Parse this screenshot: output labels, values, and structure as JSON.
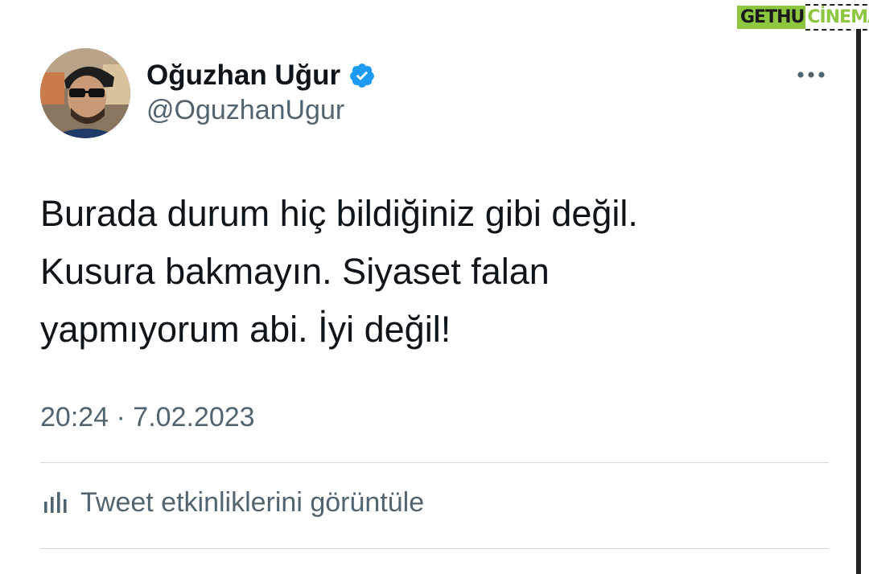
{
  "tweet": {
    "author": {
      "display_name": "Oğuzhan Uğur",
      "handle": "@OguzhanUgur",
      "verified_icon": "verified-badge-icon",
      "avatar": "profile-photo"
    },
    "text_lines": [
      "Burada durum hiç bildiğiniz gibi değil.",
      "Kusura bakmayın. Siyaset falan",
      "yapmıyorum abi. İyi değil!"
    ],
    "timestamp": "20:24 · 7.02.2023",
    "more_icon": "more-options-icon",
    "activity": {
      "icon": "analytics-bars-icon",
      "label": "Tweet etkinliklerini görüntüle"
    }
  },
  "watermark": {
    "part1": "GETHU",
    "part2": "CİNEMA"
  },
  "colors": {
    "primary_text": "#0f1419",
    "secondary_text": "#536471",
    "verified_blue": "#1d9bf0",
    "divider": "#cfd9de",
    "watermark_green": "#8dc63f"
  }
}
